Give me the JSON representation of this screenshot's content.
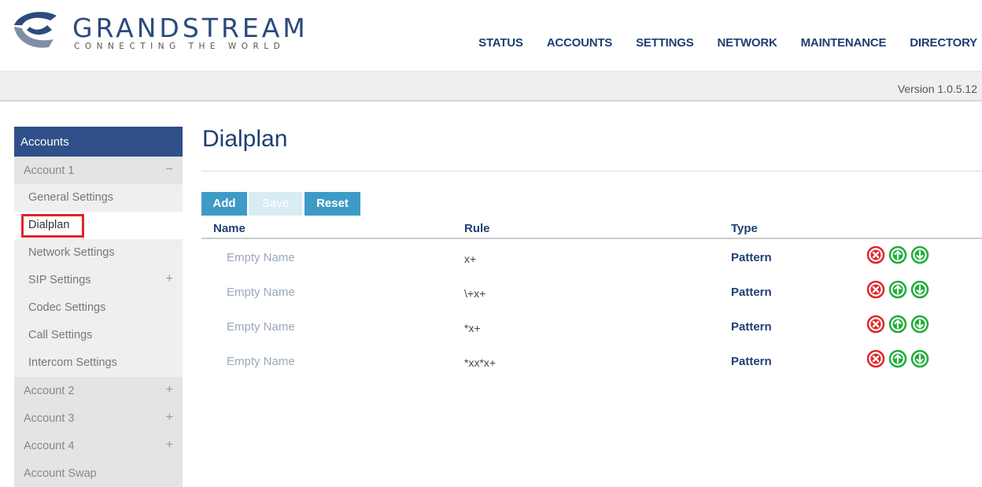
{
  "brand": {
    "name": "GRANDSTREAM",
    "tagline": "CONNECTING THE WORLD"
  },
  "nav": [
    "STATUS",
    "ACCOUNTS",
    "SETTINGS",
    "NETWORK",
    "MAINTENANCE",
    "DIRECTORY"
  ],
  "version": "Version 1.0.5.12",
  "sidebar": {
    "header": "Accounts",
    "account1": {
      "label": "Account 1",
      "toggle": "−",
      "items": [
        {
          "label": "General Settings",
          "toggle": ""
        },
        {
          "label": "Dialplan",
          "toggle": ""
        },
        {
          "label": "Network Settings",
          "toggle": ""
        },
        {
          "label": "SIP Settings",
          "toggle": "+"
        },
        {
          "label": "Codec Settings",
          "toggle": ""
        },
        {
          "label": "Call Settings",
          "toggle": ""
        },
        {
          "label": "Intercom Settings",
          "toggle": ""
        }
      ]
    },
    "others": [
      {
        "label": "Account 2",
        "toggle": "+"
      },
      {
        "label": "Account 3",
        "toggle": "+"
      },
      {
        "label": "Account 4",
        "toggle": "+"
      },
      {
        "label": "Account Swap",
        "toggle": ""
      }
    ]
  },
  "main": {
    "title": "Dialplan",
    "buttons": {
      "add": "Add",
      "save": "Save",
      "reset": "Reset"
    },
    "columns": {
      "name": "Name",
      "rule": "Rule",
      "type": "Type"
    },
    "rows": [
      {
        "name": "Empty Name",
        "rule": "x+",
        "type": "Pattern"
      },
      {
        "name": "Empty Name",
        "rule": "\\+x+",
        "type": "Pattern"
      },
      {
        "name": "Empty Name",
        "rule": "*x+",
        "type": "Pattern"
      },
      {
        "name": "Empty Name",
        "rule": "*xx*x+",
        "type": "Pattern"
      }
    ]
  },
  "colors": {
    "brand_blue": "#2f5089",
    "button_blue": "#3d9bc6",
    "delete_red": "#e0262b",
    "move_green": "#1fad3a"
  }
}
